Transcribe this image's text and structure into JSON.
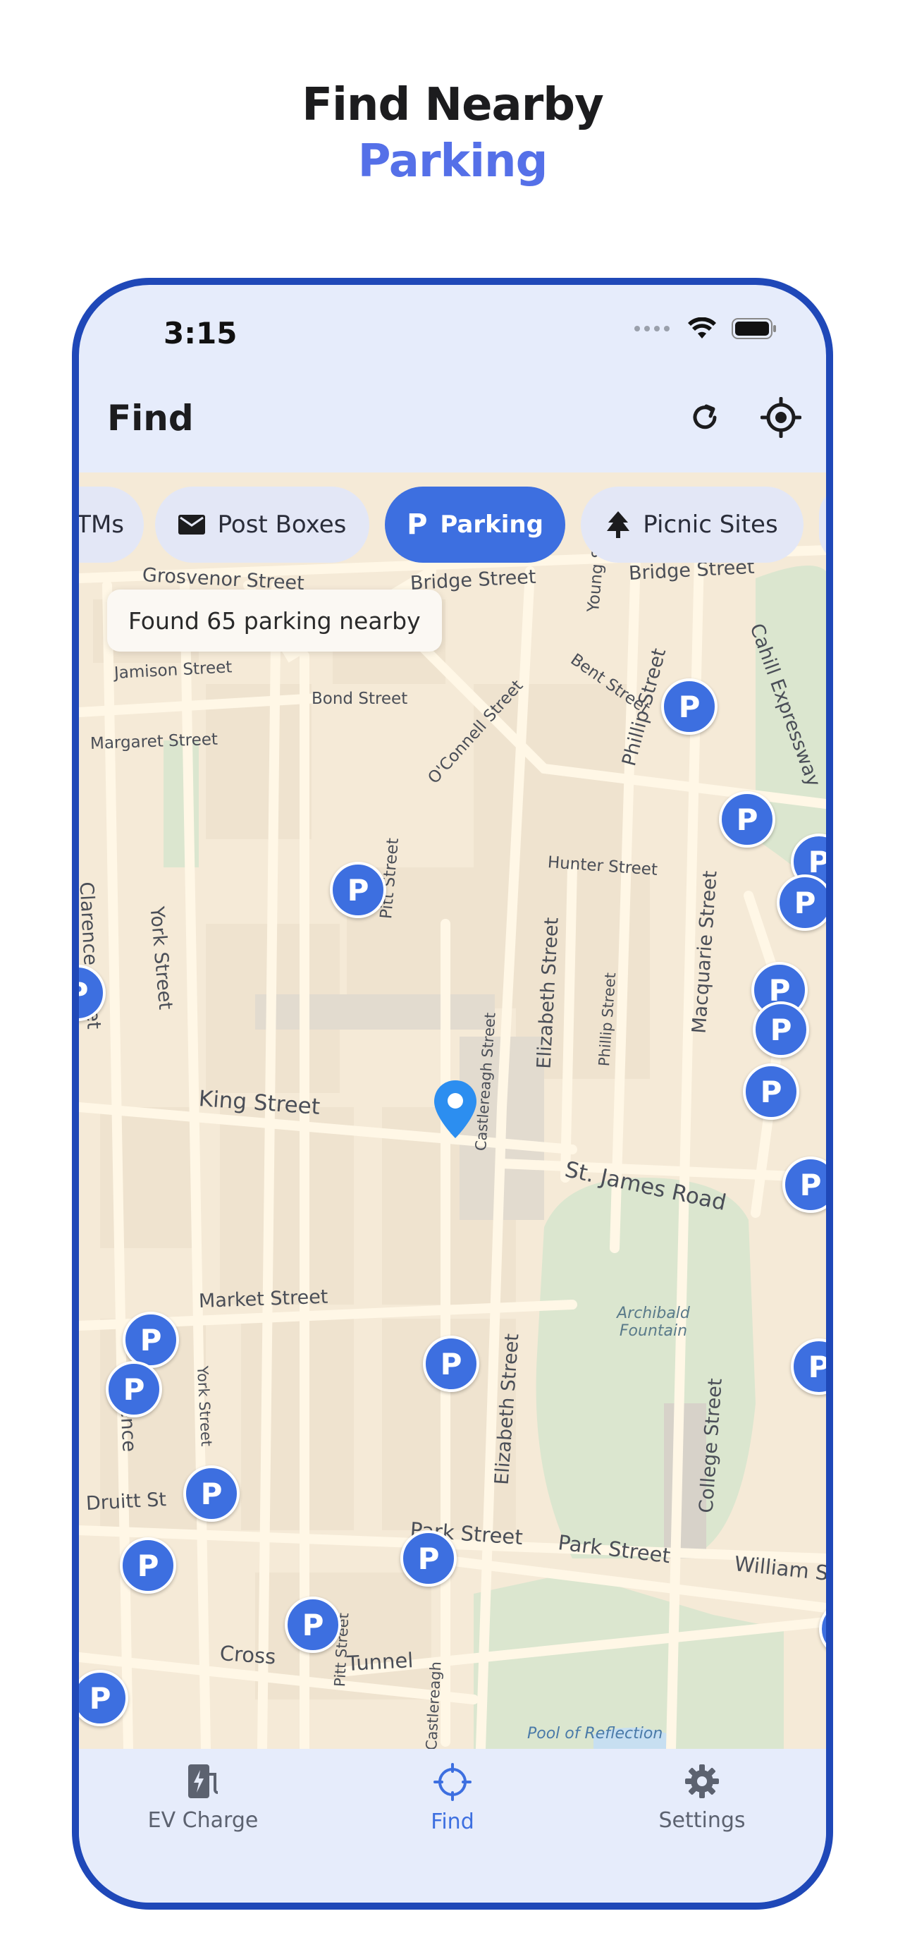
{
  "headline": {
    "line1": "Find Nearby",
    "line2": "Parking"
  },
  "status_bar": {
    "time": "3:15"
  },
  "nav": {
    "title": "Find",
    "refresh_icon": "refresh-icon",
    "locate_icon": "locate-icon"
  },
  "chips": [
    {
      "label": "ATMs",
      "icon": "atm-icon",
      "active": false
    },
    {
      "label": "Post Boxes",
      "icon": "mail-icon",
      "active": false
    },
    {
      "label": "Parking",
      "icon": "parking-icon",
      "active": true
    },
    {
      "label": "Picnic Sites",
      "icon": "tree-icon",
      "active": false
    }
  ],
  "toast": "Found 65 parking nearby",
  "marker_label": "P",
  "map_labels": {
    "grosvenor": "Grosvenor Street",
    "bridge": "Bridge Street",
    "bridge2": "Bridge Street",
    "cahill": "Cahill Expressway",
    "jamison": "Jamison Street",
    "bond": "Bond Street",
    "margaret": "Margaret Street",
    "oconnell": "O'Connell Street",
    "bent": "Bent Street",
    "phillip": "Phillip Street",
    "young": "Young St",
    "pitt": "Pitt Street",
    "hunter": "Hunter Street",
    "clarence": "Clarence Street",
    "york": "York Street",
    "macquarie": "Macquarie Street",
    "castlereagh": "Castlereagh Street",
    "elizabeth": "Elizabeth Street",
    "phillip2": "Phillip Street",
    "king": "King Street",
    "stjames": "St. James Road",
    "market": "Market Street",
    "archibald": "Archibald Fountain",
    "york2": "York Street",
    "clarence2": "Clarence",
    "elizabeth2": "Elizabeth Street",
    "college": "College Street",
    "druitt": "Druitt St",
    "park": "Park Street",
    "park2": "Park Street",
    "william": "William St",
    "pitt2": "Pitt Street",
    "castlereagh2": "Castlereagh",
    "cross": "Cross",
    "tunnel": "Tunnel",
    "pool": "Pool of Reflection"
  },
  "tabs": [
    {
      "label": "EV Charge",
      "icon": "ev-charge-icon",
      "active": false
    },
    {
      "label": "Find",
      "icon": "crosshair-icon",
      "active": true
    },
    {
      "label": "Settings",
      "icon": "gear-icon",
      "active": false
    }
  ],
  "colors": {
    "accent": "#3d6fe0",
    "frame": "#1f48b8",
    "headline_accent": "#5570e8",
    "map_base": "#f5ead7",
    "park": "#dbe6cf"
  }
}
